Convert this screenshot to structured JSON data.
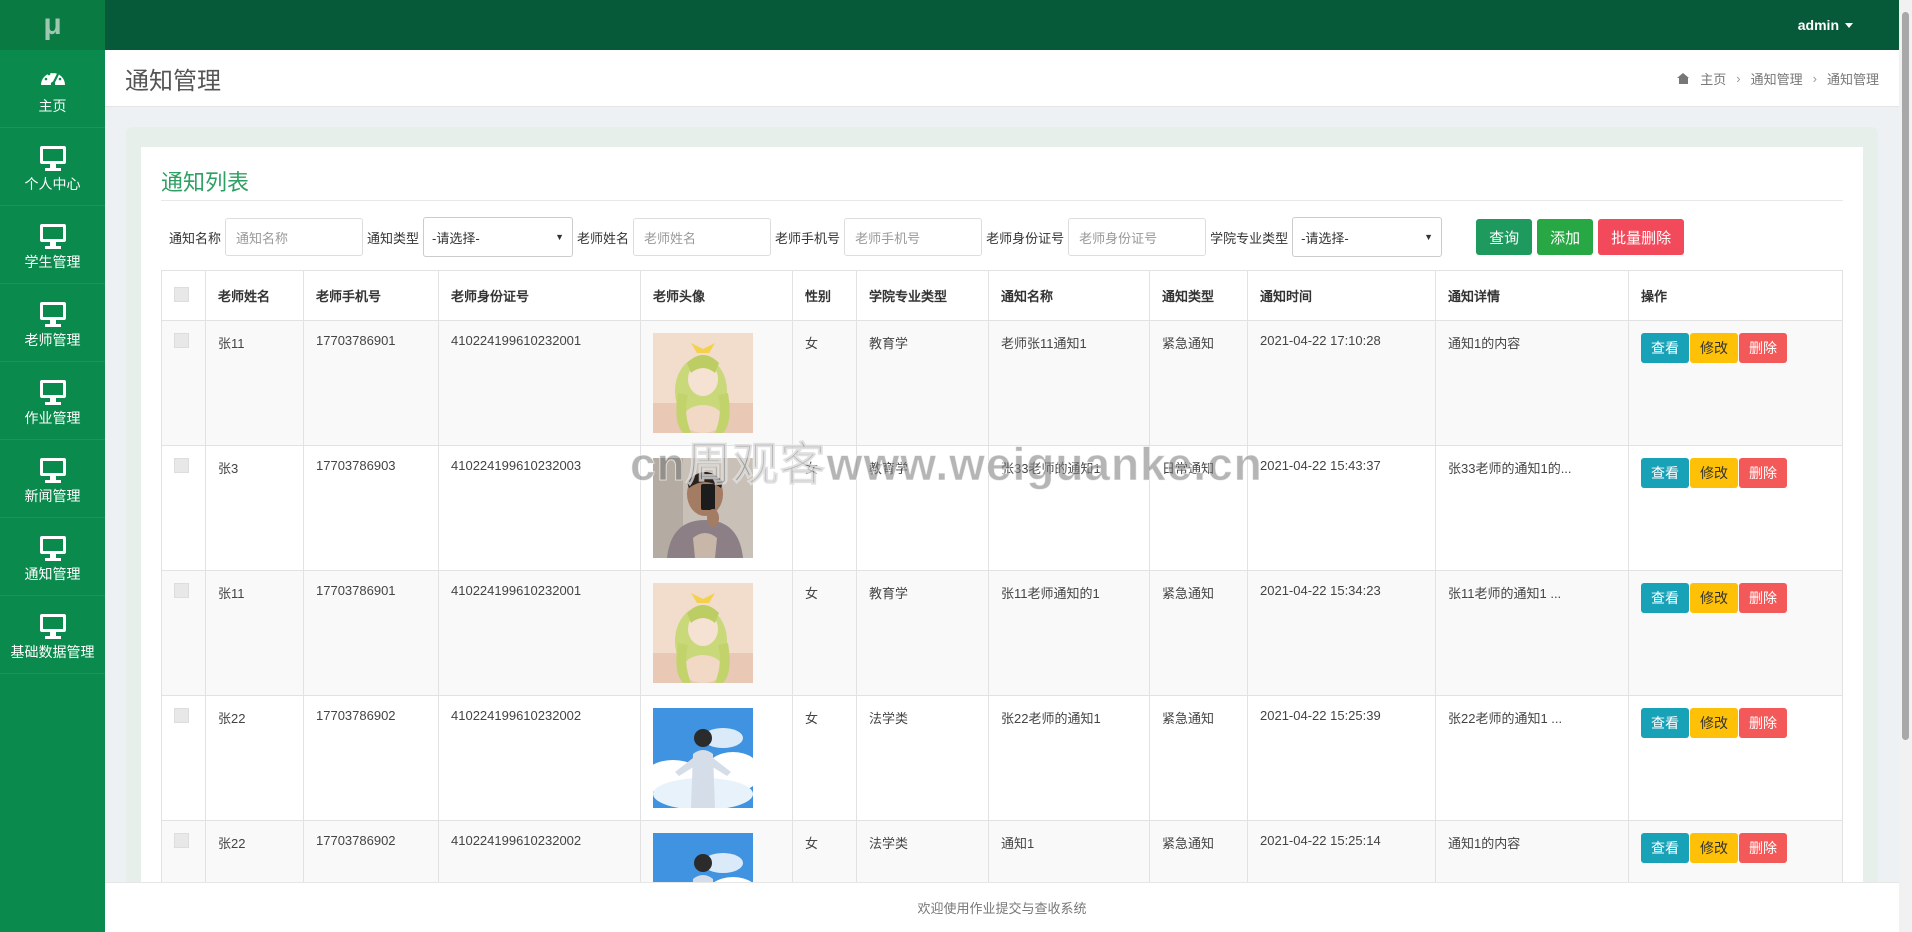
{
  "app": {
    "logo": "μ",
    "user": "admin"
  },
  "sidebar": {
    "items": [
      {
        "label": "主页",
        "icon": "dashboard-icon"
      },
      {
        "label": "个人中心",
        "icon": "monitor-icon"
      },
      {
        "label": "学生管理",
        "icon": "monitor-icon"
      },
      {
        "label": "老师管理",
        "icon": "monitor-icon"
      },
      {
        "label": "作业管理",
        "icon": "monitor-icon"
      },
      {
        "label": "新闻管理",
        "icon": "monitor-icon"
      },
      {
        "label": "通知管理",
        "icon": "monitor-icon"
      },
      {
        "label": "基础数据管理",
        "icon": "monitor-icon"
      }
    ]
  },
  "header": {
    "title": "通知管理",
    "breadcrumb": [
      "主页",
      "通知管理",
      "通知管理"
    ]
  },
  "panel": {
    "title": "通知列表"
  },
  "filters": {
    "notice_name": {
      "label": "通知名称",
      "placeholder": "通知名称"
    },
    "notice_type": {
      "label": "通知类型",
      "value": "-请选择-"
    },
    "teacher_name": {
      "label": "老师姓名",
      "placeholder": "老师姓名"
    },
    "teacher_phone": {
      "label": "老师手机号",
      "placeholder": "老师手机号"
    },
    "teacher_id": {
      "label": "老师身份证号",
      "placeholder": "老师身份证号"
    },
    "major_type": {
      "label": "学院专业类型",
      "value": "-请选择-"
    },
    "btn_query": "查询",
    "btn_add": "添加",
    "btn_batch_delete": "批量删除"
  },
  "table": {
    "headers": [
      "老师姓名",
      "老师手机号",
      "老师身份证号",
      "老师头像",
      "性别",
      "学院专业类型",
      "通知名称",
      "通知类型",
      "通知时间",
      "通知详情",
      "操作"
    ],
    "rows": [
      {
        "name": "张11",
        "phone": "17703786901",
        "id": "410224199610232001",
        "avatar": "avatar-anime-girl",
        "gender": "女",
        "major": "教育学",
        "notice_name": "老师张11通知1",
        "notice_type": "紧急通知",
        "time": "2021-04-22 17:10:28",
        "detail": "通知1的内容"
      },
      {
        "name": "张3",
        "phone": "17703786903",
        "id": "410224199610232003",
        "avatar": "avatar-selfie",
        "gender": "女",
        "major": "教育学",
        "notice_name": "张33老师的通知1",
        "notice_type": "日常通知",
        "time": "2021-04-22 15:43:37",
        "detail": "张33老师的通知1的..."
      },
      {
        "name": "张11",
        "phone": "17703786901",
        "id": "410224199610232001",
        "avatar": "avatar-anime-girl",
        "gender": "女",
        "major": "教育学",
        "notice_name": "张11老师通知的1",
        "notice_type": "紧急通知",
        "time": "2021-04-22 15:34:23",
        "detail": "张11老师的通知1 ..."
      },
      {
        "name": "张22",
        "phone": "17703786902",
        "id": "410224199610232002",
        "avatar": "avatar-sky-boy",
        "gender": "女",
        "major": "法学类",
        "notice_name": "张22老师的通知1",
        "notice_type": "紧急通知",
        "time": "2021-04-22 15:25:39",
        "detail": "张22老师的通知1 ..."
      },
      {
        "name": "张22",
        "phone": "17703786902",
        "id": "410224199610232002",
        "avatar": "avatar-sky-boy",
        "gender": "女",
        "major": "法学类",
        "notice_name": "通知1",
        "notice_type": "紧急通知",
        "time": "2021-04-22 15:25:14",
        "detail": "通知1的内容"
      }
    ],
    "actions": {
      "view": "查看",
      "edit": "修改",
      "delete": "删除"
    }
  },
  "footer": {
    "text": "欢迎使用作业提交与查收系统"
  },
  "watermark": "cn周观客www.weiguanke.cn",
  "colors": {
    "sidebar": "#0a8a4c",
    "topbar": "#075a39",
    "accent": "#2fa063",
    "view": "#17a2b8",
    "edit": "#ffc107",
    "delete": "#f35959"
  }
}
